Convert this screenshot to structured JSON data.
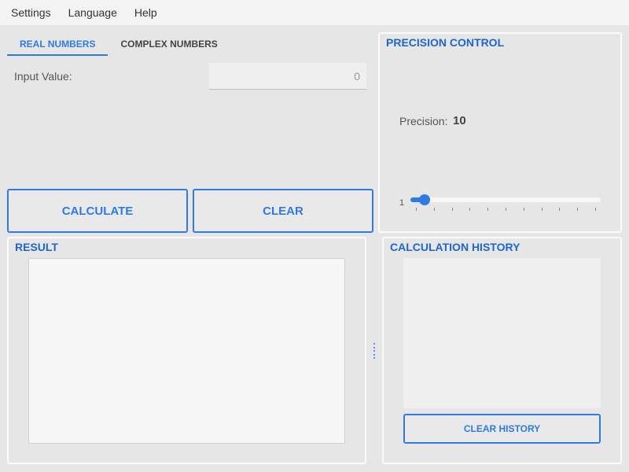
{
  "menu": {
    "items": [
      "Settings",
      "Language",
      "Help"
    ]
  },
  "tabs": [
    "REAL NUMBERS",
    "COMPLEX NUMBERS"
  ],
  "input": {
    "label": "Input Value:",
    "placeholder": "0"
  },
  "actions": {
    "calculate": "CALCULATE",
    "clear": "CLEAR"
  },
  "precision": {
    "title": "PRECISION CONTROL",
    "label": "Precision:",
    "value": "10",
    "slider_min_label": "1",
    "slider_level": 0.0
  },
  "result": {
    "title": "RESULT"
  },
  "history": {
    "title": "CALCULATION HISTORY",
    "clear_label": "CLEAR HISTORY"
  },
  "colors": {
    "accent": "#2f7ae5",
    "title": "#1f66cc",
    "background": "#e6e6e6",
    "menubar": "#f3f3f3"
  }
}
